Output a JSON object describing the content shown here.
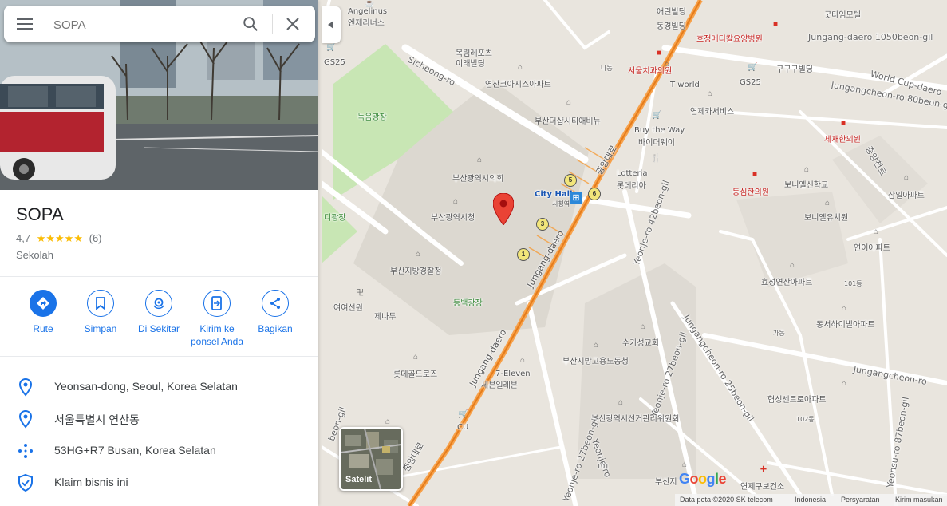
{
  "search": {
    "placeholder": "SOPA",
    "value": ""
  },
  "place": {
    "name": "SOPA",
    "rating": "4,7",
    "stars": "★★★★★",
    "review_count": "(6)",
    "category": "Sekolah"
  },
  "actions": [
    {
      "label": "Rute",
      "icon": "directions-icon"
    },
    {
      "label": "Simpan",
      "icon": "bookmark-icon"
    },
    {
      "label": "Di Sekitar",
      "icon": "nearby-icon"
    },
    {
      "label": "Kirim ke ponsel Anda",
      "icon": "send-to-phone-icon"
    },
    {
      "label": "Bagikan",
      "icon": "share-icon"
    }
  ],
  "info": [
    {
      "text": "Yeonsan-dong, Seoul, Korea Selatan",
      "icon": "location-pin-icon"
    },
    {
      "text": "서울특별시 연산동",
      "icon": "location-pin-icon"
    },
    {
      "text": "53HG+R7 Busan, Korea Selatan",
      "icon": "plus-code-icon"
    },
    {
      "text": "Klaim bisnis ini",
      "icon": "verified-shield-icon"
    }
  ],
  "map": {
    "labels": {
      "angelinus_en": "Angelinus",
      "angelinus_ko": "엔제리너스",
      "erin": "애린빌딩",
      "dongyoung": "동경빌딩",
      "hojung": "호정메디칼요양병원",
      "gutaik": "굿타임모텔",
      "jungang1050": "Jungang-daero 1050beon-gil",
      "gs25_a": "GS25",
      "gs25_b": "GS25",
      "mokrim": "목림레포츠",
      "irae": "이래빌딩",
      "sicheong_ro": "Sicheong-ro",
      "seoulchi": "서울치과의원",
      "na": "나동",
      "gugu": "구구구빌딩",
      "worldcup": "World Cup-daero",
      "jungangcheon80": "Jungangcheon-ro 80beon-gil",
      "yeonsan_apt": "연산코아시스아파트",
      "tworld": "T world",
      "yeonje_cs": "연제카서비스",
      "nokeum": "녹음광장",
      "busan_the": "부산더샵시티애비뉴",
      "buy_the_way_en": "Buy the Way",
      "buy_the_way_ko": "바이더웨이",
      "sejae": "세재한의원",
      "jungang_ro": "중앙천로",
      "lotteria_en": "Lotteria",
      "lotteria_ko": "롯데리아",
      "council": "부산광역시의회",
      "dongsim": "동심한의원",
      "bonelle_sin": "보니엘신학교",
      "samil": "삼일아파트",
      "cityhall_en": "City Hall",
      "cityhall_ko": "시청역",
      "busan_cityhall": "부산광역시청",
      "bonelle_kinder": "보니엘유치원",
      "gwangjang": "디광장",
      "yeonie_apt": "연이아파트",
      "yeonje_42": "Yeonje-ro 42beon-gil",
      "busan_police": "부산지방경찰청",
      "hyoseong": "효성연산아파트",
      "dongbaek": "동백광장",
      "jungang_daero_a": "Jungang-daero",
      "jungang_daero_b": "Jungang-daero",
      "yeoyeoseon": "여여선원",
      "jenadu": "제나두",
      "dongseo": "동서하이빌아파트",
      "suga": "수가성교회",
      "busan_labor": "부산지방고용노동청",
      "lotte_golf": "롯데골드로즈",
      "seven_en": "7-Eleven",
      "seven_ko": "세븐일레븐",
      "jungangcheon_25": "Jungangcheon-ro 25beon-gil",
      "jungangcheon_ro": "Jungangcheon-ro",
      "election": "부산광역시선거관리위원회",
      "hyupseong": "협성센트로아파트",
      "cu": "CU",
      "yeonje_ro": "Yeonje-ro",
      "yeonje_27": "Yeonje-ro 27beon-gil",
      "yeonje_27b": "Yeonje-ro 27beon-gil",
      "yeonsu_87": "Yeonsu-ro 87beon-gil",
      "busan_ji": "부산지",
      "yeonje_gu": "연제구보건소",
      "beon_gil": "beon-gil",
      "seon_gil": "Jungang-daero",
      "dong_101_a": "101동",
      "dong_101_b": "101",
      "dong_102": "102동",
      "ga": "가동",
      "jungang_dong": "중앙대로",
      "jungang_dong_b": "중앙대로"
    },
    "subway_numbers": [
      "5",
      "6",
      "3",
      "1"
    ],
    "satellite_label": "Satelit",
    "google_logo": "Google",
    "footer": {
      "data": "Data peta ©2020 SK telecom",
      "country": "Indonesia",
      "terms": "Persyaratan",
      "feedback": "Kirim masukan"
    },
    "colors": {
      "road_major": "#f59c3a",
      "park": "#c8e6b4",
      "pin": "#ea4335",
      "accent": "#1a73e8"
    }
  }
}
